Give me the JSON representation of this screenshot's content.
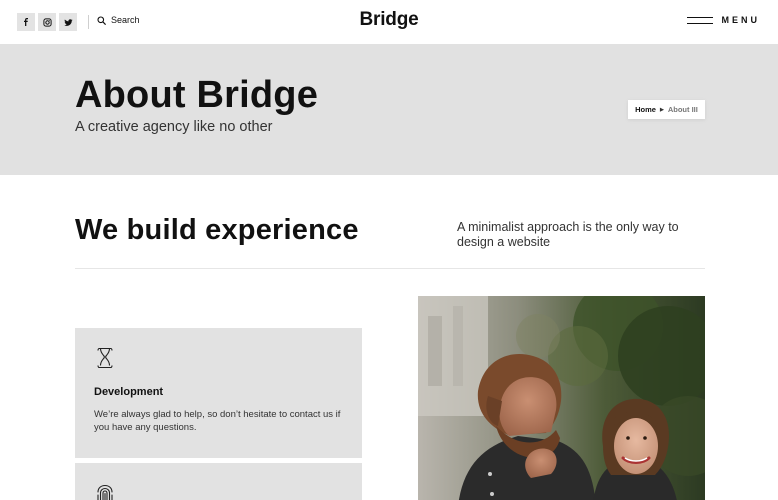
{
  "header": {
    "social": [
      "facebook-icon",
      "instagram-icon",
      "twitter-icon"
    ],
    "search_label": "Search",
    "logo": "Bridge",
    "menu_label": "MENU"
  },
  "hero": {
    "title": "About Bridge",
    "subtitle": "A creative agency like no other",
    "breadcrumb": {
      "home": "Home",
      "current": "About III"
    }
  },
  "intro": {
    "title": "We build experience",
    "text": "A minimalist approach is the only way to design a website"
  },
  "cards": [
    {
      "icon": "hourglass-icon",
      "title": "Development",
      "text": "We’re always glad to help, so don’t hesitate to contact us if you have any questions."
    },
    {
      "icon": "fingerprint-icon"
    }
  ],
  "colors": {
    "band": "#e1e1e1",
    "card": "#e2e2e2",
    "text": "#111111"
  }
}
